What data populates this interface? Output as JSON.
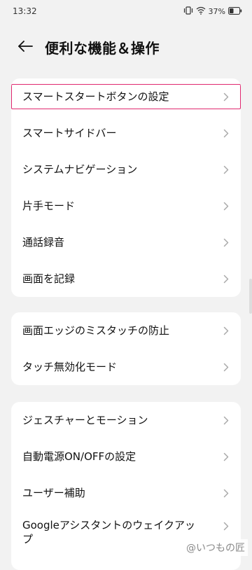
{
  "status_bar": {
    "time": "13:32",
    "battery": "37%"
  },
  "header": {
    "title": "便利な機能＆操作"
  },
  "groups": [
    {
      "items": [
        {
          "label": "スマートスタートボタンの設定",
          "highlighted": true
        },
        {
          "label": "スマートサイドバー"
        },
        {
          "label": "システムナビゲーション"
        },
        {
          "label": "片手モード"
        },
        {
          "label": "通話録音"
        },
        {
          "label": "画面を記録"
        }
      ]
    },
    {
      "items": [
        {
          "label": "画面エッジのミスタッチの防止"
        },
        {
          "label": "タッチ無効化モード"
        }
      ]
    },
    {
      "items": [
        {
          "label": "ジェスチャーとモーション"
        },
        {
          "label": "自動電源ON/OFFの設定"
        },
        {
          "label": "ユーザー補助"
        },
        {
          "label": "Googleアシスタントのウェイクアップ"
        }
      ]
    }
  ],
  "watermark": "@いつもの匠",
  "colors": {
    "background": "#f2f2f2",
    "card": "#ffffff",
    "highlight_border": "#e0286f"
  },
  "icons": {
    "back": "arrow-left-icon",
    "chevron": "chevron-right-icon"
  }
}
